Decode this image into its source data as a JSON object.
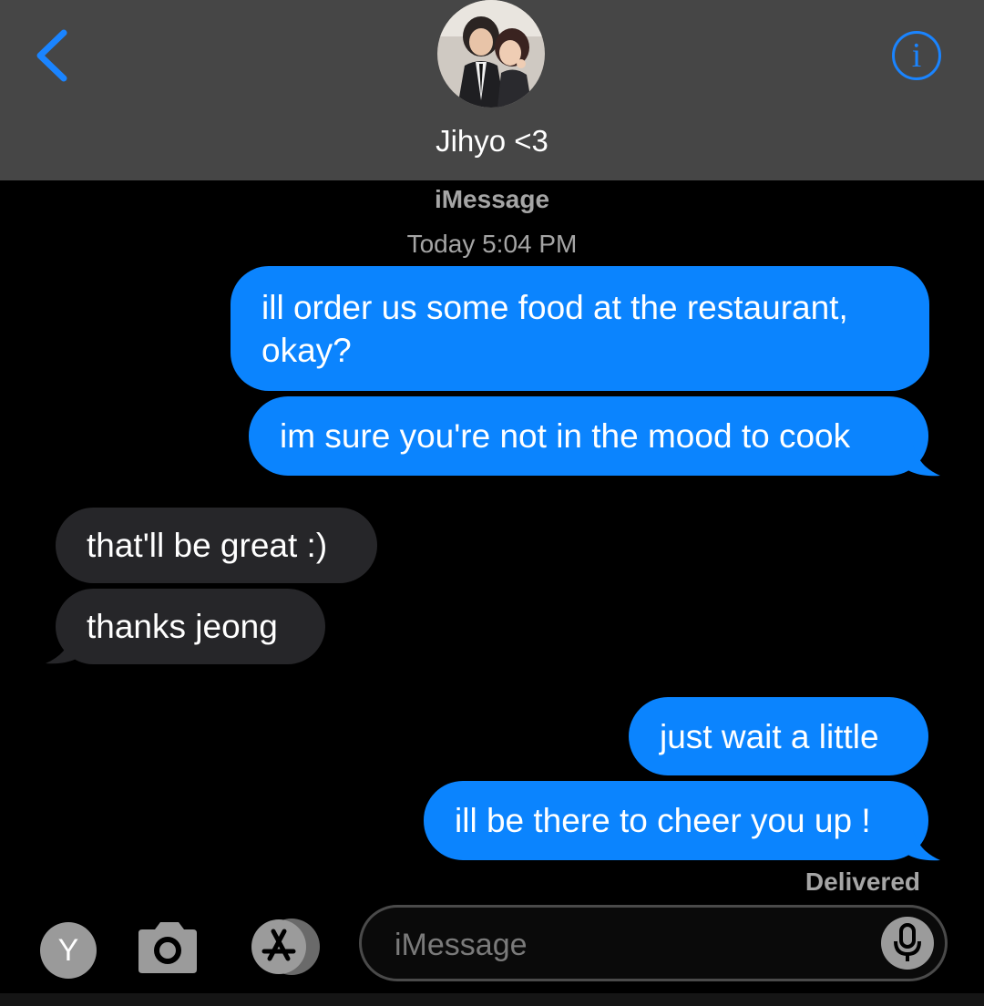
{
  "header": {
    "contact_name": "Jihyo <3",
    "back_icon": "chevron-left-icon",
    "info_icon": "i",
    "accent_color": "#1a84ff",
    "background_color": "#464646"
  },
  "thread": {
    "service_label": "iMessage",
    "timestamp": "Today 5:04 PM",
    "messages": [
      {
        "direction": "sent",
        "text_line1": "ill order us some food at the restaurant,",
        "text_line2": "okay?"
      },
      {
        "direction": "sent",
        "text": "im sure you're not in the mood to cook"
      },
      {
        "direction": "received",
        "text": "that'll be great :)"
      },
      {
        "direction": "received",
        "text": "thanks jeong"
      },
      {
        "direction": "sent",
        "text": "just wait a little"
      },
      {
        "direction": "sent",
        "text": "ill be there to cheer you up !"
      }
    ],
    "status": "Delivered",
    "sent_color": "#0b84fe",
    "received_color": "#262629"
  },
  "composer": {
    "y_button_label": "Y",
    "camera_icon": "camera-icon",
    "apps_icon": "app-store-icon",
    "placeholder": "iMessage",
    "mic_icon": "microphone-icon"
  }
}
